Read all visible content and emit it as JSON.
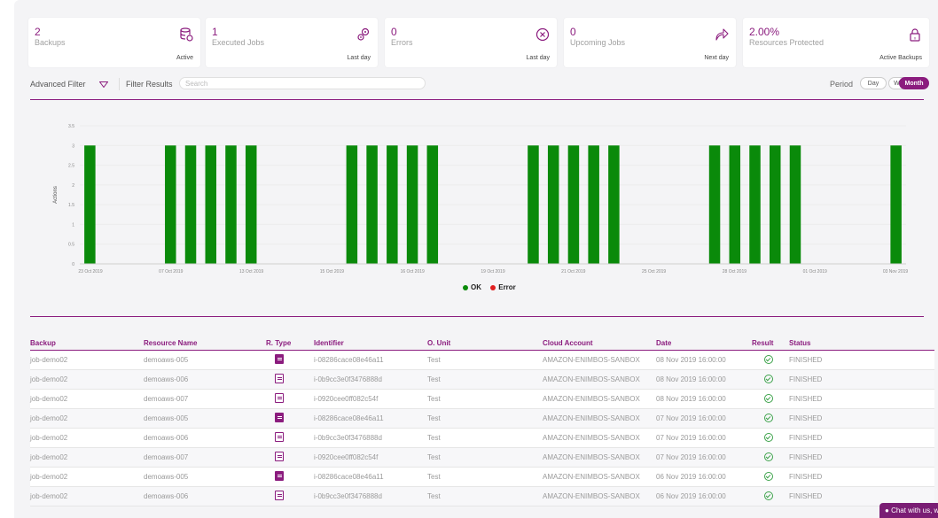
{
  "cards": [
    {
      "num": "2",
      "label": "Backups",
      "sub": "Active",
      "icon": "database-icon"
    },
    {
      "num": "1",
      "label": "Executed Jobs",
      "sub": "Last day",
      "icon": "gears-icon"
    },
    {
      "num": "0",
      "label": "Errors",
      "sub": "Last day",
      "icon": "error-circle-icon"
    },
    {
      "num": "0",
      "label": "Upcoming Jobs",
      "sub": "Next day",
      "icon": "forward-arrow-icon"
    },
    {
      "num": "2.00%",
      "label": "Resources Protected",
      "sub": "Active Backups",
      "icon": "lock-icon"
    }
  ],
  "filters": {
    "advanced": "Advanced Filter",
    "results_label": "Filter Results",
    "search_placeholder": "Search",
    "period_label": "Period",
    "period_options": [
      "Day",
      "Week",
      "Month"
    ],
    "period_selected": "Month"
  },
  "chart_data": {
    "type": "bar",
    "ylabel": "Actions",
    "ylim": [
      0,
      3.5
    ],
    "y_ticks": [
      "0",
      "0.5",
      "1",
      "1.5",
      "2",
      "2.5",
      "3",
      "3.5"
    ],
    "x_tick_labels": [
      "23 Oct 2019",
      "07 Oct 2019",
      "13 Oct 2019",
      "15 Oct 2019",
      "16 Oct 2019",
      "19 Oct 2019",
      "21 Oct 2019",
      "25 Oct 2019",
      "28 Oct 2019",
      "01 Oct 2019",
      "03 Nov 2019"
    ],
    "series": [
      {
        "name": "OK",
        "color": "#0a8a0a",
        "values": [
          3,
          0,
          0,
          0,
          3,
          3,
          3,
          3,
          3,
          0,
          0,
          0,
          0,
          3,
          3,
          3,
          3,
          3,
          0,
          0,
          0,
          0,
          3,
          3,
          3,
          3,
          3,
          0,
          0,
          0,
          0,
          3,
          3,
          3,
          3,
          3,
          0,
          0,
          0,
          0,
          3
        ]
      },
      {
        "name": "Error",
        "color": "#e02020",
        "values": [
          0,
          0,
          0,
          0,
          0,
          0,
          0,
          0,
          0,
          0,
          0,
          0,
          0,
          0,
          0,
          0,
          0,
          0,
          0,
          0,
          0,
          0,
          0,
          0,
          0,
          0,
          0,
          0,
          0,
          0,
          0,
          0,
          0,
          0,
          0,
          0,
          0,
          0,
          0,
          0,
          0
        ]
      }
    ],
    "legend": "bottom"
  },
  "table": {
    "headers": [
      "Backup",
      "Resource Name",
      "R. Type",
      "Identifier",
      "O. Unit",
      "Cloud Account",
      "Date",
      "Result",
      "Status"
    ],
    "rows": [
      {
        "backup": "job-demo02",
        "resource": "demoaws-005",
        "rtype": "server-icon",
        "id": "i-08286cace08e46a11",
        "unit": "Test",
        "account": "AMAZON-ENIMBOS-SANBOX",
        "date": "08 Nov 2019 16:00:00",
        "result": "check-circle-icon",
        "status": "FINISHED"
      },
      {
        "backup": "job-demo02",
        "resource": "demoaws-006",
        "rtype": "server-icon",
        "id": "i-0b9cc3e0f3476888d",
        "unit": "Test",
        "account": "AMAZON-ENIMBOS-SANBOX",
        "date": "08 Nov 2019 16:00:00",
        "result": "check-circle-icon",
        "status": "FINISHED"
      },
      {
        "backup": "job-demo02",
        "resource": "demoaws-007",
        "rtype": "server-icon",
        "id": "i-0920cee0ff082c54f",
        "unit": "Test",
        "account": "AMAZON-ENIMBOS-SANBOX",
        "date": "08 Nov 2019 16:00:00",
        "result": "check-circle-icon",
        "status": "FINISHED"
      },
      {
        "backup": "job-demo02",
        "resource": "demoaws-005",
        "rtype": "server-icon",
        "id": "i-08286cace08e46a11",
        "unit": "Test",
        "account": "AMAZON-ENIMBOS-SANBOX",
        "date": "07 Nov 2019 16:00:00",
        "result": "check-circle-icon",
        "status": "FINISHED"
      },
      {
        "backup": "job-demo02",
        "resource": "demoaws-006",
        "rtype": "server-icon",
        "id": "i-0b9cc3e0f3476888d",
        "unit": "Test",
        "account": "AMAZON-ENIMBOS-SANBOX",
        "date": "07 Nov 2019 16:00:00",
        "result": "check-circle-icon",
        "status": "FINISHED"
      },
      {
        "backup": "job-demo02",
        "resource": "demoaws-007",
        "rtype": "server-icon",
        "id": "i-0920cee0ff082c54f",
        "unit": "Test",
        "account": "AMAZON-ENIMBOS-SANBOX",
        "date": "07 Nov 2019 16:00:00",
        "result": "check-circle-icon",
        "status": "FINISHED"
      },
      {
        "backup": "job-demo02",
        "resource": "demoaws-005",
        "rtype": "server-icon",
        "id": "i-08286cace08e46a11",
        "unit": "Test",
        "account": "AMAZON-ENIMBOS-SANBOX",
        "date": "06 Nov 2019 16:00:00",
        "result": "check-circle-icon",
        "status": "FINISHED"
      },
      {
        "backup": "job-demo02",
        "resource": "demoaws-006",
        "rtype": "server-icon",
        "id": "i-0b9cc3e0f3476888d",
        "unit": "Test",
        "account": "AMAZON-ENIMBOS-SANBOX",
        "date": "06 Nov 2019 16:00:00",
        "result": "check-circle-icon",
        "status": "FINISHED"
      }
    ]
  },
  "chat": {
    "label": "Chat with us, w"
  },
  "colors": {
    "brand": "#8b1c7e",
    "ok": "#0a8a0a",
    "error": "#e02020"
  }
}
